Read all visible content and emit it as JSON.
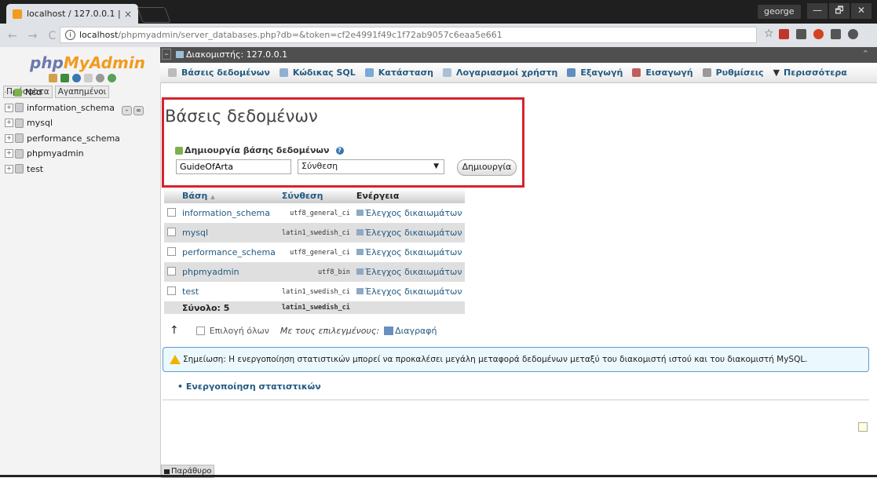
{
  "browser": {
    "tab_title": "localhost / 127.0.0.1 | ph",
    "tab_close": "×",
    "user": "george",
    "window_buttons": [
      "—",
      "🗗",
      "✕"
    ],
    "url_host": "localhost",
    "url_rest": "/phpmyadmin/server_databases.php?db=&token=cf2e4991f49c1f72ab9057c6eaa5e661",
    "star": "☆",
    "ext_colors": [
      "#c2352c",
      "#555555",
      "#d24321",
      "#555555",
      "#555555"
    ]
  },
  "left_panel": {
    "logo_php": "php",
    "logo_myadmin": "MyAdmin",
    "tabs": [
      "Πρόσφατα",
      "Αγαπημένοι"
    ],
    "tree_new": "Νέα",
    "databases": [
      "information_schema",
      "mysql",
      "performance_schema",
      "phpmyadmin",
      "test"
    ]
  },
  "serverbar": {
    "label": "Διακομιστής: 127.0.0.1"
  },
  "menu": {
    "items": [
      "Βάσεις δεδομένων",
      "Κώδικας SQL",
      "Κατάσταση",
      "Λογαριασμοί χρήστη",
      "Εξαγωγή",
      "Εισαγωγή",
      "Ρυθμίσεις",
      "Περισσότερα"
    ],
    "more_prefix": "▼"
  },
  "main": {
    "title": "Βάσεις δεδομένων",
    "create_label": "Δημιουργία βάσης δεδομένων",
    "db_name_value": "GuideOfArta",
    "collation_value": "Σύνθεση",
    "create_button": "Δημιουργία"
  },
  "table": {
    "headers": {
      "db": "Βάση",
      "sort": "▲",
      "collation": "Σύνθεση",
      "action": "Ενέργεια"
    },
    "rows": [
      {
        "name": "information_schema",
        "collation": "utf8_general_ci",
        "action": "Έλεγχος δικαιωμάτων"
      },
      {
        "name": "mysql",
        "collation": "latin1_swedish_ci",
        "action": "Έλεγχος δικαιωμάτων"
      },
      {
        "name": "performance_schema",
        "collation": "utf8_general_ci",
        "action": "Έλεγχος δικαιωμάτων"
      },
      {
        "name": "phpmyadmin",
        "collation": "utf8_bin",
        "action": "Έλεγχος δικαιωμάτων"
      },
      {
        "name": "test",
        "collation": "latin1_swedish_ci",
        "action": "Έλεγχος δικαιωμάτων"
      }
    ],
    "total_label": "Σύνολο: 5",
    "total_collation": "latin1_swedish_ci"
  },
  "bulk": {
    "select_all": "Επιλογή όλων",
    "with_selected": "Με τους επιλεγμένους:",
    "delete": "Διαγραφή"
  },
  "notice": "Σημείωση: Η ενεργοποίηση στατιστικών μπορεί να προκαλέσει μεγάλη μεταφορά δεδομένων μεταξύ του διακομιστή ιστού και του διακομιστή MySQL.",
  "enable_stats": "Ενεργοποίηση στατιστικών",
  "console_tab": "Παράθυρο"
}
